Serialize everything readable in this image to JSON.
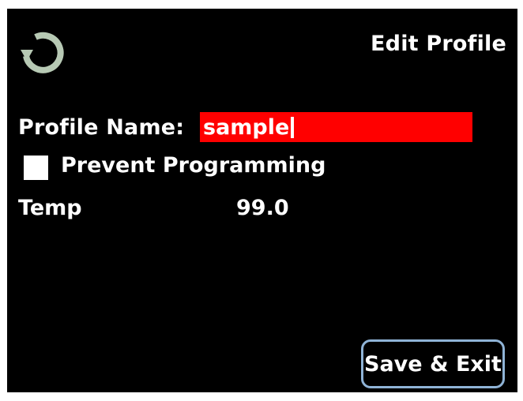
{
  "header": {
    "title": "Edit Profile",
    "back_icon": "refresh-back-icon"
  },
  "form": {
    "profile_name_label": "Profile Name:",
    "profile_name_value": "sample",
    "prevent_programming_label": "Prevent Programming",
    "prevent_programming_checked": false,
    "temp_label": "Temp",
    "temp_value": "99.0"
  },
  "footer": {
    "save_exit_label": "Save & Exit"
  },
  "colors": {
    "background": "#000000",
    "text": "#ffffff",
    "name_field_bg": "#ff0000",
    "button_border": "#8fb3d6",
    "icon": "#b7c9b4"
  }
}
